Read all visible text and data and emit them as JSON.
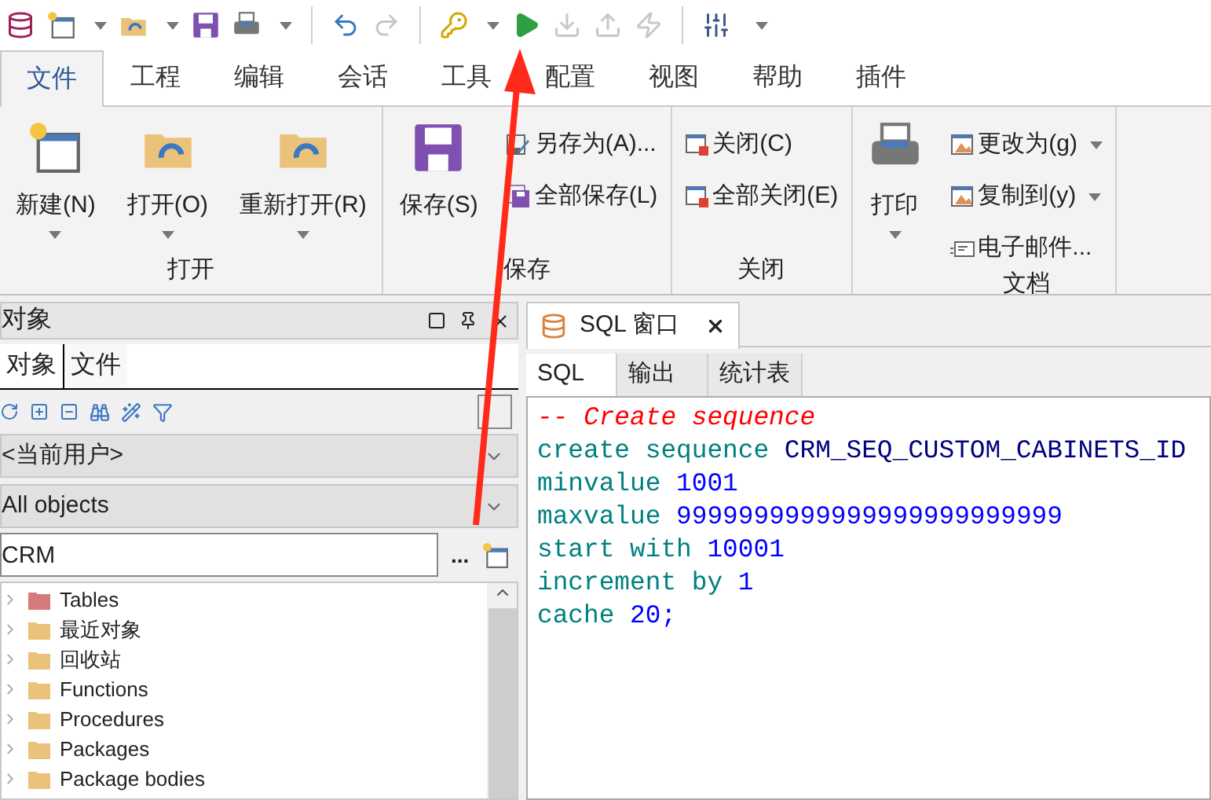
{
  "quick_toolbar": [
    {
      "kind": "database",
      "disabled": false
    },
    {
      "kind": "new",
      "disabled": false
    },
    {
      "kind": "open",
      "disabled": false
    },
    {
      "kind": "save",
      "disabled": false
    },
    {
      "kind": "print",
      "disabled": false
    },
    {
      "kind": "undo",
      "disabled": false
    },
    {
      "kind": "redo",
      "disabled": true
    },
    {
      "kind": "key",
      "disabled": false
    },
    {
      "kind": "run",
      "disabled": false
    },
    {
      "kind": "down",
      "disabled": true
    },
    {
      "kind": "up",
      "disabled": true
    },
    {
      "kind": "break",
      "disabled": true
    },
    {
      "kind": "sliders",
      "disabled": false
    }
  ],
  "menu_tabs": [
    {
      "label": "文件",
      "selected": true
    },
    {
      "label": "工程",
      "selected": false
    },
    {
      "label": "编辑",
      "selected": false
    },
    {
      "label": "会话",
      "selected": false
    },
    {
      "label": "工具",
      "selected": false
    },
    {
      "label": "配置",
      "selected": false
    },
    {
      "label": "视图",
      "selected": false
    },
    {
      "label": "帮助",
      "selected": false
    },
    {
      "label": "插件",
      "selected": false
    }
  ],
  "ribbon_groups": [
    {
      "title": "打开",
      "items": [
        {
          "label": "新建(N)",
          "kind": "large",
          "dropdown": true
        },
        {
          "label": "打开(O)",
          "kind": "large",
          "dropdown": true
        },
        {
          "label": "重新打开(R)",
          "kind": "large",
          "dropdown": true
        }
      ]
    },
    {
      "title": "保存",
      "items": [
        {
          "label": "保存(S)",
          "kind": "large"
        },
        {
          "label": "另存为(A)...",
          "kind": "small"
        },
        {
          "label": "全部保存(L)",
          "kind": "small"
        }
      ]
    },
    {
      "title": "关闭",
      "items": [
        {
          "label": "关闭(C)",
          "kind": "small"
        },
        {
          "label": "全部关闭(E)",
          "kind": "small"
        }
      ]
    },
    {
      "items": [
        {
          "label": "打印",
          "kind": "large",
          "dropdown": true
        }
      ]
    },
    {
      "title": "文档",
      "items": [
        {
          "label": "更改为(g)",
          "kind": "small",
          "dropdown": true
        },
        {
          "label": "复制到(y)",
          "kind": "small",
          "dropdown": true
        },
        {
          "label": "电子邮件...",
          "kind": "small"
        }
      ]
    }
  ],
  "object_panel": {
    "title": "对象",
    "tabs": [
      {
        "label": "对象",
        "selected": true
      },
      {
        "label": "文件",
        "selected": false
      }
    ],
    "user_select": {
      "value": "<当前用户>"
    },
    "type_select": {
      "value": "All objects"
    },
    "filter": {
      "value": "CRM"
    },
    "browse_button": "...",
    "tree": [
      {
        "label": "Tables",
        "color": "#d47a7a"
      },
      {
        "label": "最近对象",
        "color": "#eac27a"
      },
      {
        "label": "回收站",
        "color": "#eac27a"
      },
      {
        "label": "Functions",
        "color": "#eac27a"
      },
      {
        "label": "Procedures",
        "color": "#eac27a"
      },
      {
        "label": "Packages",
        "color": "#eac27a"
      },
      {
        "label": "Package bodies",
        "color": "#eac27a"
      }
    ]
  },
  "sql_window": {
    "title": "SQL 窗口",
    "tabs": [
      {
        "label": "SQL",
        "selected": true
      },
      {
        "label": "输出",
        "selected": false
      },
      {
        "label": "统计表",
        "selected": false
      }
    ],
    "lines": [
      [
        {
          "text": "-- Create sequence",
          "kind": "comment"
        }
      ],
      [
        {
          "text": "create sequence",
          "kind": "keyword"
        },
        {
          "text": "CRM_SEQ_CUSTOM_CABINETS_ID",
          "kind": "identifier"
        }
      ],
      [
        {
          "text": "minvalue",
          "kind": "keyword"
        },
        {
          "text": "1001",
          "kind": "number"
        }
      ],
      [
        {
          "text": "maxvalue",
          "kind": "keyword"
        },
        {
          "text": "9999999999999999999999999",
          "kind": "number"
        }
      ],
      [
        {
          "text": "start with",
          "kind": "keyword"
        },
        {
          "text": "10001",
          "kind": "number"
        }
      ],
      [
        {
          "text": "increment by",
          "kind": "keyword"
        },
        {
          "text": "1",
          "kind": "number"
        }
      ],
      [
        {
          "text": "cache",
          "kind": "keyword"
        },
        {
          "text": "20;",
          "kind": "number"
        }
      ]
    ]
  }
}
